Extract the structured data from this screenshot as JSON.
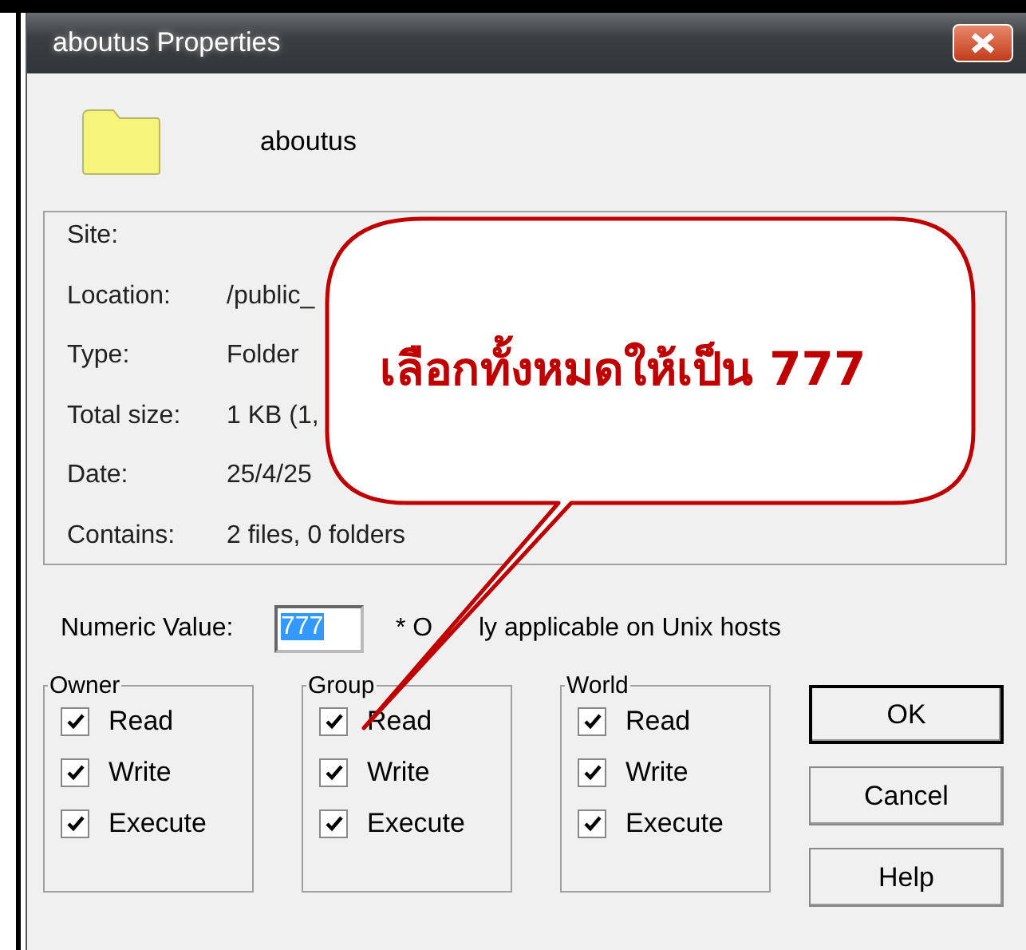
{
  "window": {
    "title": "aboutus Properties"
  },
  "folder": {
    "name": "aboutus"
  },
  "info": [
    {
      "label": "Site:"
    },
    {
      "label": "Location:",
      "value": "/public_"
    },
    {
      "label": "Type:",
      "value": "Folder"
    },
    {
      "label": "Total size:",
      "value": "1 KB (1,"
    },
    {
      "label": "Date:",
      "value": "25/4/25"
    },
    {
      "label": "Contains:",
      "value": "2 files, 0 folders"
    }
  ],
  "numeric": {
    "label": "Numeric Value:",
    "value": "777",
    "note": [
      "* O",
      "ly applicable on Unix hosts"
    ]
  },
  "groups": [
    {
      "title": "Owner",
      "permissions": [
        {
          "label": "Read",
          "checked": true
        },
        {
          "label": "Write",
          "checked": true
        },
        {
          "label": "Execute",
          "checked": true
        }
      ]
    },
    {
      "title": "Group",
      "permissions": [
        {
          "label": "Read",
          "checked": true
        },
        {
          "label": "Write",
          "checked": true
        },
        {
          "label": "Execute",
          "checked": true
        }
      ]
    },
    {
      "title": "World",
      "permissions": [
        {
          "label": "Read",
          "checked": true
        },
        {
          "label": "Write",
          "checked": true
        },
        {
          "label": "Execute",
          "checked": true
        }
      ]
    }
  ],
  "buttons": [
    {
      "label": "OK",
      "default": true
    },
    {
      "label": "Cancel",
      "default": false
    },
    {
      "label": "Help",
      "default": false
    }
  ],
  "callout": {
    "text": "เลือกทั้งหมดให้เป็น 777"
  }
}
